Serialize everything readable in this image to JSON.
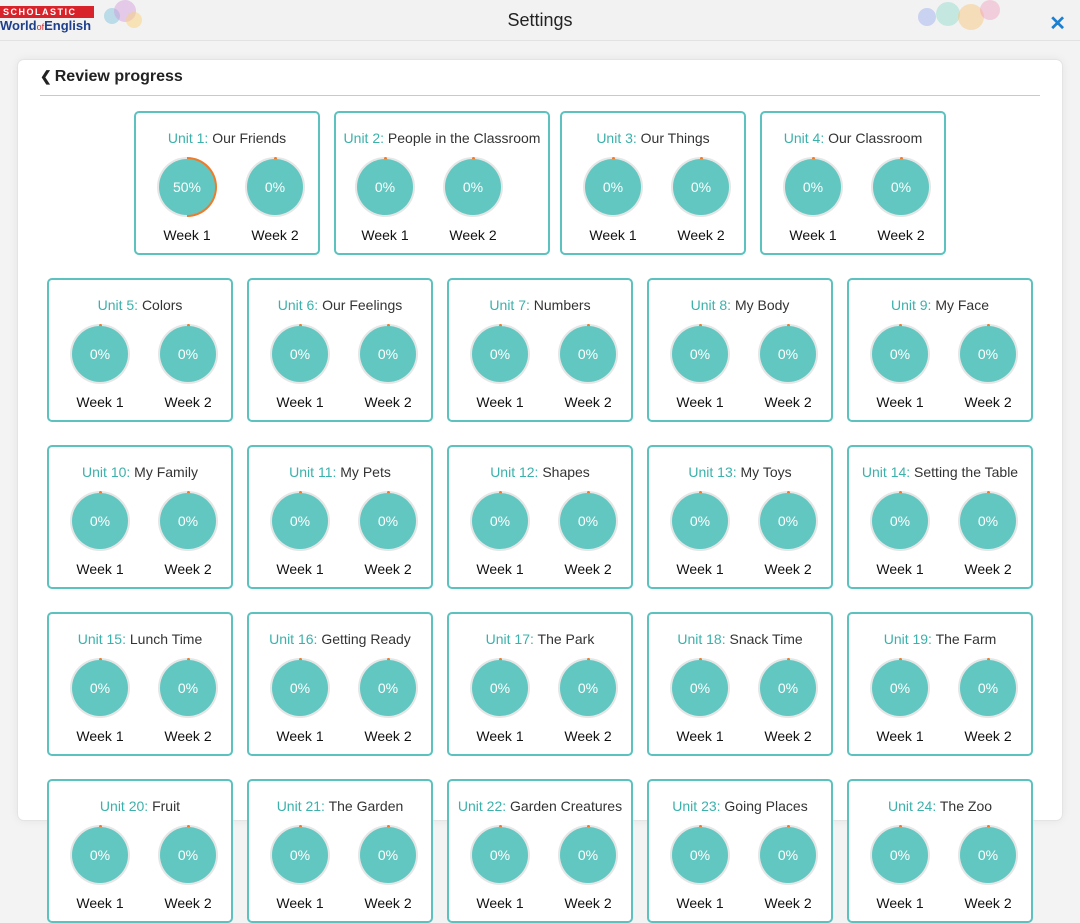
{
  "header": {
    "title": "Settings",
    "logo_top": "SCHOLASTIC",
    "logo_bottom_a": "World",
    "logo_bottom_of": "of",
    "logo_bottom_b": "English",
    "close_icon": "close-icon",
    "accent_color": "#1c7fd0"
  },
  "panel": {
    "back_label": "Review progress",
    "back_icon": "chevron-left-icon"
  },
  "colors": {
    "ring_fill": "#62c7c1",
    "card_border": "#5bc2bf",
    "progress_arc": "#f07a2a",
    "unit_number": "#3bb1ab"
  },
  "units": [
    {
      "num": "Unit 1:",
      "name": "Our Friends",
      "weeks": [
        {
          "label": "Week 1",
          "value": "50%",
          "progress": 0.5
        },
        {
          "label": "Week 2",
          "value": "0%",
          "progress": 0
        }
      ]
    },
    {
      "num": "Unit 2:",
      "name": "People in the Classroom",
      "weeks": [
        {
          "label": "Week 1",
          "value": "0%",
          "progress": 0
        },
        {
          "label": "Week 2",
          "value": "0%",
          "progress": 0
        }
      ]
    },
    {
      "num": "Unit 3:",
      "name": "Our Things",
      "weeks": [
        {
          "label": "Week 1",
          "value": "0%",
          "progress": 0
        },
        {
          "label": "Week 2",
          "value": "0%",
          "progress": 0
        }
      ]
    },
    {
      "num": "Unit 4:",
      "name": "Our Classroom",
      "weeks": [
        {
          "label": "Week 1",
          "value": "0%",
          "progress": 0
        },
        {
          "label": "Week 2",
          "value": "0%",
          "progress": 0
        }
      ]
    },
    {
      "num": "Unit 5:",
      "name": "Colors",
      "weeks": [
        {
          "label": "Week 1",
          "value": "0%",
          "progress": 0
        },
        {
          "label": "Week 2",
          "value": "0%",
          "progress": 0
        }
      ]
    },
    {
      "num": "Unit 6:",
      "name": "Our Feelings",
      "weeks": [
        {
          "label": "Week 1",
          "value": "0%",
          "progress": 0
        },
        {
          "label": "Week 2",
          "value": "0%",
          "progress": 0
        }
      ]
    },
    {
      "num": "Unit 7:",
      "name": "Numbers",
      "weeks": [
        {
          "label": "Week 1",
          "value": "0%",
          "progress": 0
        },
        {
          "label": "Week 2",
          "value": "0%",
          "progress": 0
        }
      ]
    },
    {
      "num": "Unit 8:",
      "name": "My Body",
      "weeks": [
        {
          "label": "Week 1",
          "value": "0%",
          "progress": 0
        },
        {
          "label": "Week 2",
          "value": "0%",
          "progress": 0
        }
      ]
    },
    {
      "num": "Unit 9:",
      "name": "My Face",
      "weeks": [
        {
          "label": "Week 1",
          "value": "0%",
          "progress": 0
        },
        {
          "label": "Week 2",
          "value": "0%",
          "progress": 0
        }
      ]
    },
    {
      "num": "Unit 10:",
      "name": "My Family",
      "weeks": [
        {
          "label": "Week 1",
          "value": "0%",
          "progress": 0
        },
        {
          "label": "Week 2",
          "value": "0%",
          "progress": 0
        }
      ]
    },
    {
      "num": "Unit 11:",
      "name": "My Pets",
      "weeks": [
        {
          "label": "Week 1",
          "value": "0%",
          "progress": 0
        },
        {
          "label": "Week 2",
          "value": "0%",
          "progress": 0
        }
      ]
    },
    {
      "num": "Unit 12:",
      "name": "Shapes",
      "weeks": [
        {
          "label": "Week 1",
          "value": "0%",
          "progress": 0
        },
        {
          "label": "Week 2",
          "value": "0%",
          "progress": 0
        }
      ]
    },
    {
      "num": "Unit 13:",
      "name": "My Toys",
      "weeks": [
        {
          "label": "Week 1",
          "value": "0%",
          "progress": 0
        },
        {
          "label": "Week 2",
          "value": "0%",
          "progress": 0
        }
      ]
    },
    {
      "num": "Unit 14:",
      "name": "Setting the Table",
      "weeks": [
        {
          "label": "Week 1",
          "value": "0%",
          "progress": 0
        },
        {
          "label": "Week 2",
          "value": "0%",
          "progress": 0
        }
      ]
    },
    {
      "num": "Unit 15:",
      "name": "Lunch Time",
      "weeks": [
        {
          "label": "Week 1",
          "value": "0%",
          "progress": 0
        },
        {
          "label": "Week 2",
          "value": "0%",
          "progress": 0
        }
      ]
    },
    {
      "num": "Unit 16:",
      "name": "Getting Ready",
      "weeks": [
        {
          "label": "Week 1",
          "value": "0%",
          "progress": 0
        },
        {
          "label": "Week 2",
          "value": "0%",
          "progress": 0
        }
      ]
    },
    {
      "num": "Unit 17:",
      "name": "The Park",
      "weeks": [
        {
          "label": "Week 1",
          "value": "0%",
          "progress": 0
        },
        {
          "label": "Week 2",
          "value": "0%",
          "progress": 0
        }
      ]
    },
    {
      "num": "Unit 18:",
      "name": "Snack Time",
      "weeks": [
        {
          "label": "Week 1",
          "value": "0%",
          "progress": 0
        },
        {
          "label": "Week 2",
          "value": "0%",
          "progress": 0
        }
      ]
    },
    {
      "num": "Unit 19:",
      "name": "The Farm",
      "weeks": [
        {
          "label": "Week 1",
          "value": "0%",
          "progress": 0
        },
        {
          "label": "Week 2",
          "value": "0%",
          "progress": 0
        }
      ]
    },
    {
      "num": "Unit 20:",
      "name": "Fruit",
      "weeks": [
        {
          "label": "Week 1",
          "value": "0%",
          "progress": 0
        },
        {
          "label": "Week 2",
          "value": "0%",
          "progress": 0
        }
      ]
    },
    {
      "num": "Unit 21:",
      "name": "The Garden",
      "weeks": [
        {
          "label": "Week 1",
          "value": "0%",
          "progress": 0
        },
        {
          "label": "Week 2",
          "value": "0%",
          "progress": 0
        }
      ]
    },
    {
      "num": "Unit 22:",
      "name": "Garden Creatures",
      "weeks": [
        {
          "label": "Week 1",
          "value": "0%",
          "progress": 0
        },
        {
          "label": "Week 2",
          "value": "0%",
          "progress": 0
        }
      ]
    },
    {
      "num": "Unit 23:",
      "name": "Going Places",
      "weeks": [
        {
          "label": "Week 1",
          "value": "0%",
          "progress": 0
        },
        {
          "label": "Week 2",
          "value": "0%",
          "progress": 0
        }
      ]
    },
    {
      "num": "Unit 24:",
      "name": "The Zoo",
      "weeks": [
        {
          "label": "Week 1",
          "value": "0%",
          "progress": 0
        },
        {
          "label": "Week 2",
          "value": "0%",
          "progress": 0
        }
      ]
    }
  ]
}
